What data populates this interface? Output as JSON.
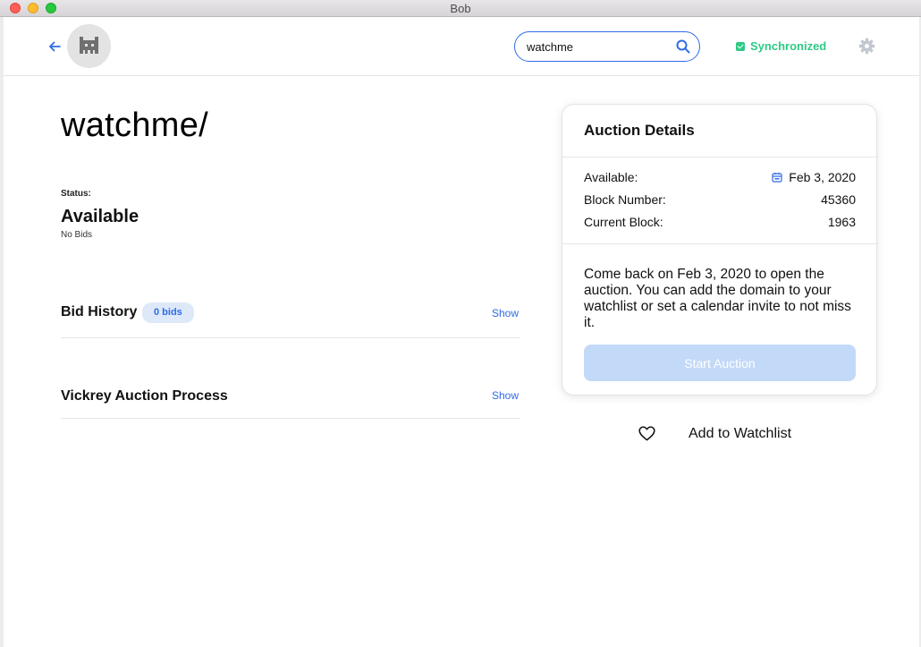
{
  "window": {
    "title": "Bob"
  },
  "header": {
    "search_value": "watchme",
    "sync_status": "Synchronized",
    "accent_color": "#2e6be6",
    "sync_color": "#2fc986"
  },
  "domain": {
    "name": "watchme/",
    "status_label": "Status:",
    "status_value": "Available",
    "status_sub": "No Bids"
  },
  "sections": {
    "bid_history": {
      "title": "Bid History",
      "badge": "0 bids",
      "action": "Show"
    },
    "vickrey": {
      "title": "Vickrey Auction Process",
      "action": "Show"
    }
  },
  "auction": {
    "title": "Auction Details",
    "rows": [
      {
        "label": "Available:",
        "value": "Feb 3, 2020",
        "icon": "calendar-icon"
      },
      {
        "label": "Block Number:",
        "value": "45360"
      },
      {
        "label": "Current Block:",
        "value": "1963"
      }
    ],
    "message": "Come back on Feb 3, 2020 to open the auction. You can add the domain to your watchlist or set a calendar invite to not miss it.",
    "button": "Start Auction"
  },
  "watchlist": {
    "label": "Add to Watchlist",
    "icon": "heart-icon"
  }
}
